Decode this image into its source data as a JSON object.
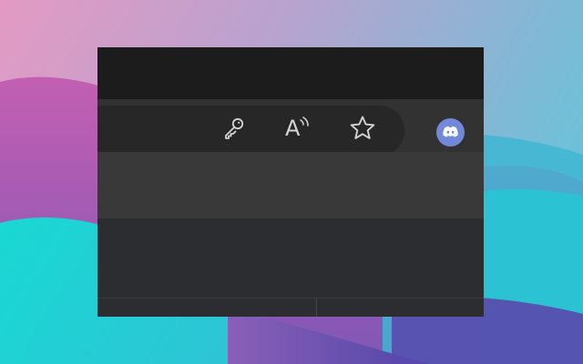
{
  "wallpaper": {
    "colors": {
      "pink": "#e39ac3",
      "blue": "#7fb6d4",
      "teal": "#2fd1d5",
      "purple": "#8a5fb8",
      "violet": "#6a4fb0",
      "deep": "#4b46a8"
    }
  },
  "browser": {
    "theme": {
      "titlebar": "#1c1c1c",
      "toolbar": "#323232",
      "address_bar": "#272727",
      "icon_color": "#d4d4d4",
      "content": "#2b2d31"
    },
    "toolbar": {
      "icons": {
        "key": "key-icon",
        "read_aloud": "read-aloud-icon",
        "read_aloud_letter": "A",
        "favorite": "star-icon"
      }
    },
    "extension": {
      "icon": "discord-icon",
      "color": "#7289da"
    }
  }
}
